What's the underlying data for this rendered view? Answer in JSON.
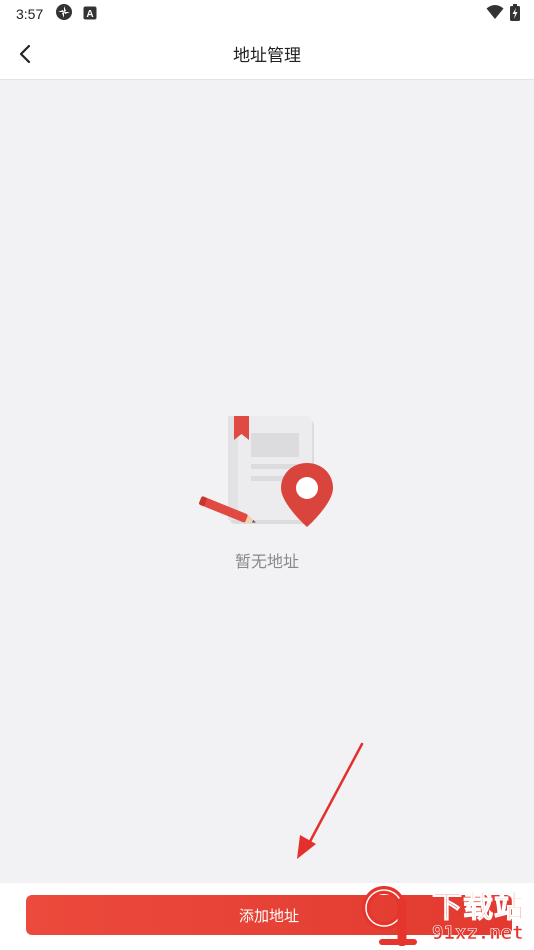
{
  "status_bar": {
    "time": "3:57",
    "left_icons": [
      "sync-icon",
      "a-badge-icon"
    ],
    "right_icons": [
      "wifi-icon",
      "battery-charging-icon"
    ],
    "badge_letter": "A"
  },
  "header": {
    "back_icon": "chevron-left-icon",
    "title": "地址管理"
  },
  "empty_state": {
    "illustration": "address-book-with-location-pin",
    "message": "暂无地址"
  },
  "bottom_bar": {
    "add_button_label": "添加地址"
  },
  "watermark": {
    "text_cn": "下载站",
    "text_en": "91xz.net"
  },
  "colors": {
    "accent": "#e5352c",
    "background": "#f2f2f5",
    "header_bg": "#ffffff",
    "muted_text": "#888888"
  }
}
